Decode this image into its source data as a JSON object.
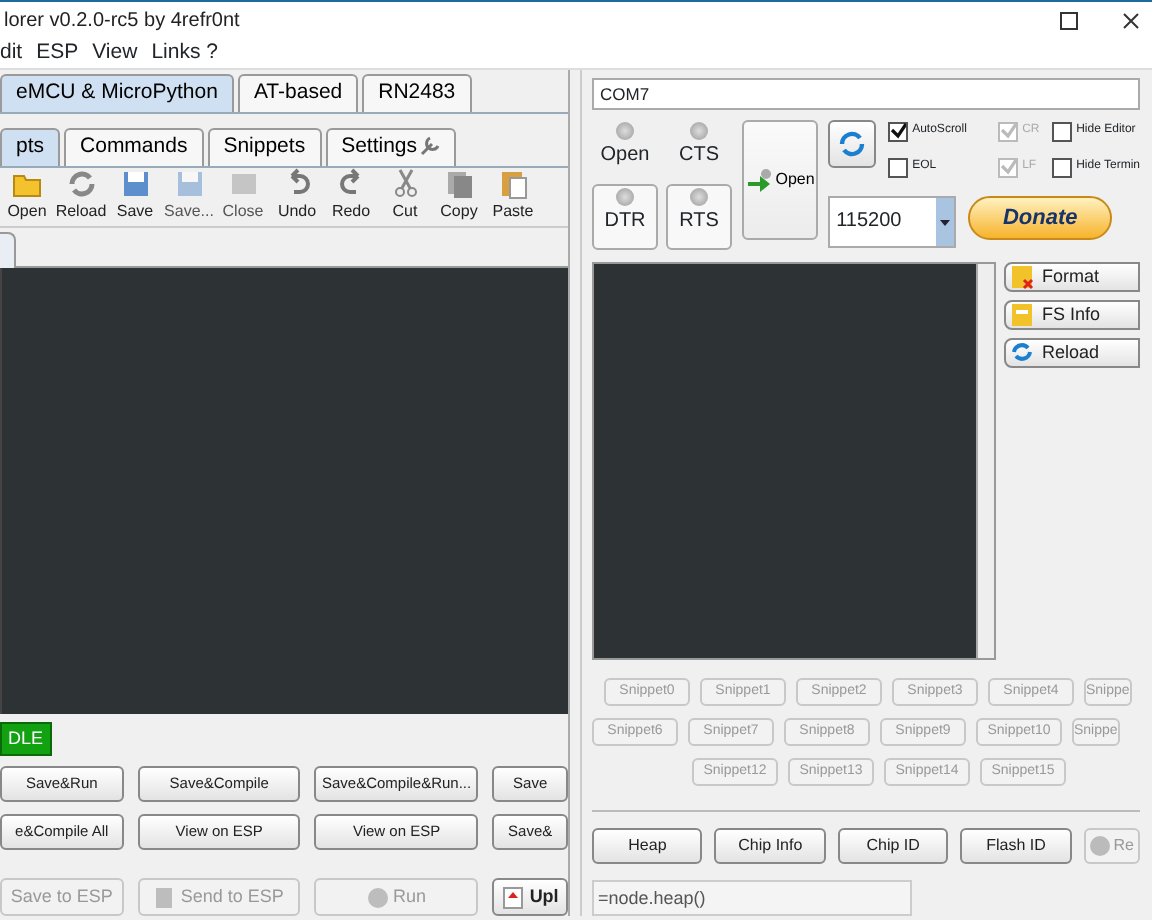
{
  "window": {
    "title": "lorer v0.2.0-rc5 by 4refr0nt"
  },
  "menu": [
    "dit",
    "ESP",
    "View",
    "Links ?"
  ],
  "left": {
    "tabs": [
      {
        "label": "eMCU & MicroPython",
        "selected": true
      },
      {
        "label": "AT-based",
        "selected": false
      },
      {
        "label": "RN2483",
        "selected": false
      }
    ],
    "subtabs": [
      {
        "label": "pts",
        "selected": true
      },
      {
        "label": "Commands",
        "selected": false
      },
      {
        "label": "Snippets",
        "selected": false
      },
      {
        "label": "Settings",
        "selected": false
      }
    ],
    "toolbar": [
      {
        "label": "Open",
        "disabled": false
      },
      {
        "label": "Reload",
        "disabled": false
      },
      {
        "label": "Save",
        "disabled": false
      },
      {
        "label": "Save...",
        "disabled": true
      },
      {
        "label": "Close",
        "disabled": true
      },
      {
        "label": "Undo",
        "disabled": false
      },
      {
        "label": "Redo",
        "disabled": false
      },
      {
        "label": "Cut",
        "disabled": false
      },
      {
        "label": "Copy",
        "disabled": false
      },
      {
        "label": "Paste",
        "disabled": false
      }
    ],
    "status": "DLE",
    "button_rows": [
      [
        "Save&Run",
        "Save&Compile",
        "Save&Compile&Run...",
        "Save"
      ],
      [
        "e&Compile All",
        "View on ESP",
        "View on ESP",
        "Save&"
      ]
    ],
    "bottom_buttons": [
      {
        "label": "Save to ESP",
        "disabled": true
      },
      {
        "label": "Send to ESP",
        "disabled": true
      },
      {
        "label": "Run",
        "disabled": true
      },
      {
        "label": "Upl",
        "disabled": false
      }
    ]
  },
  "right": {
    "port": "COM7",
    "indicators": [
      {
        "label": "Open",
        "kind": "led"
      },
      {
        "label": "CTS",
        "kind": "led"
      },
      {
        "label": "DTR",
        "kind": "button"
      },
      {
        "label": "RTS",
        "kind": "button"
      }
    ],
    "open_button": "Open",
    "checkboxes": [
      {
        "label": "AutoScroll",
        "checked": true,
        "disabled": false
      },
      {
        "label": "EOL",
        "checked": false,
        "disabled": false
      },
      {
        "label": "CR",
        "checked": true,
        "disabled": true
      },
      {
        "label": "LF",
        "checked": true,
        "disabled": true
      },
      {
        "label": "Hide Editor",
        "checked": false,
        "disabled": false
      },
      {
        "label": "Hide Termin",
        "checked": false,
        "disabled": false
      }
    ],
    "baud": "115200",
    "donate": "Donate",
    "side_buttons": [
      "Format",
      "FS Info",
      "Reload"
    ],
    "snippet_rows": [
      [
        "Snippet0",
        "Snippet1",
        "Snippet2",
        "Snippet3",
        "Snippet4",
        "Snippe"
      ],
      [
        "Snippet6",
        "Snippet7",
        "Snippet8",
        "Snippet9",
        "Snippet10",
        "Snippe"
      ],
      [
        "Snippet12",
        "Snippet13",
        "Snippet14",
        "Snippet15"
      ]
    ],
    "commands": [
      {
        "label": "Heap",
        "disabled": false
      },
      {
        "label": "Chip Info",
        "disabled": false
      },
      {
        "label": "Chip ID",
        "disabled": false
      },
      {
        "label": "Flash ID",
        "disabled": false
      },
      {
        "label": "Re",
        "disabled": true
      }
    ],
    "command_input": "=node.heap()"
  }
}
